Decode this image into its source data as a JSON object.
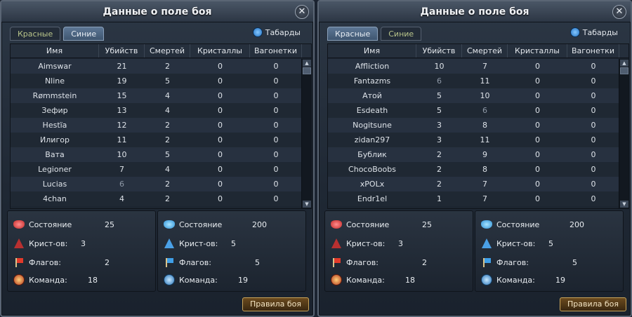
{
  "panels": [
    {
      "title": "Данные о поле боя",
      "tabs": [
        "Красные",
        "Синие"
      ],
      "active_tab": 1,
      "tabard_label": "Табарды",
      "columns": [
        "Имя",
        "Убийств",
        "Смертей",
        "Кристаллы",
        "Вагонетки"
      ],
      "rows": [
        [
          "Aimswar",
          "21",
          "2",
          "0",
          "0"
        ],
        [
          "Nline",
          "19",
          "5",
          "0",
          "0"
        ],
        [
          "Rømmstein",
          "15",
          "4",
          "0",
          "0"
        ],
        [
          "Зефир",
          "13",
          "4",
          "0",
          "0"
        ],
        [
          "Hestïa",
          "12",
          "2",
          "0",
          "0"
        ],
        [
          "Илигор",
          "11",
          "2",
          "0",
          "0"
        ],
        [
          "Вата",
          "10",
          "5",
          "0",
          "0"
        ],
        [
          "Legioner",
          "7",
          "4",
          "0",
          "0"
        ],
        [
          "Lucias",
          "6",
          "2",
          "0",
          "0"
        ],
        [
          "4chan",
          "4",
          "2",
          "0",
          "0"
        ]
      ],
      "stats_red": {
        "state_label": "Состояние",
        "state_val": "25",
        "crys_label": "Крист-ов:",
        "crys_val": "3",
        "flags_label": "Флагов:",
        "flags_val": "2",
        "team_label": "Команда:",
        "team_val": "18"
      },
      "stats_blue": {
        "state_label": "Состояние",
        "state_val": "200",
        "crys_label": "Крист-ов:",
        "crys_val": "5",
        "flags_label": "Флагов:",
        "flags_val": "5",
        "team_label": "Команда:",
        "team_val": "19"
      },
      "rules_label": "Правила боя"
    },
    {
      "title": "Данные о поле боя",
      "tabs": [
        "Красные",
        "Синие"
      ],
      "active_tab": 0,
      "tabard_label": "Табарды",
      "columns": [
        "Имя",
        "Убийств",
        "Смертей",
        "Кристаллы",
        "Вагонетки"
      ],
      "rows": [
        [
          "Affliction",
          "10",
          "7",
          "0",
          "0"
        ],
        [
          "Fantazms",
          "6",
          "11",
          "0",
          "0"
        ],
        [
          "Атой",
          "5",
          "10",
          "0",
          "0"
        ],
        [
          "Esdeath",
          "5",
          "6",
          "0",
          "0"
        ],
        [
          "Nogitsune",
          "3",
          "8",
          "0",
          "0"
        ],
        [
          "zidan297",
          "3",
          "11",
          "0",
          "0"
        ],
        [
          "Бублик",
          "2",
          "9",
          "0",
          "0"
        ],
        [
          "ChocoBoobs",
          "2",
          "8",
          "0",
          "0"
        ],
        [
          "xPOLx",
          "2",
          "7",
          "0",
          "0"
        ],
        [
          "Endr1el",
          "1",
          "7",
          "0",
          "0"
        ]
      ],
      "stats_red": {
        "state_label": "Состояние",
        "state_val": "25",
        "crys_label": "Крист-ов:",
        "crys_val": "3",
        "flags_label": "Флагов:",
        "flags_val": "2",
        "team_label": "Команда:",
        "team_val": "18"
      },
      "stats_blue": {
        "state_label": "Состояние",
        "state_val": "200",
        "crys_label": "Крист-ов:",
        "crys_val": "5",
        "flags_label": "Флагов:",
        "flags_val": "5",
        "team_label": "Команда:",
        "team_val": "19"
      },
      "rules_label": "Правила боя"
    }
  ]
}
